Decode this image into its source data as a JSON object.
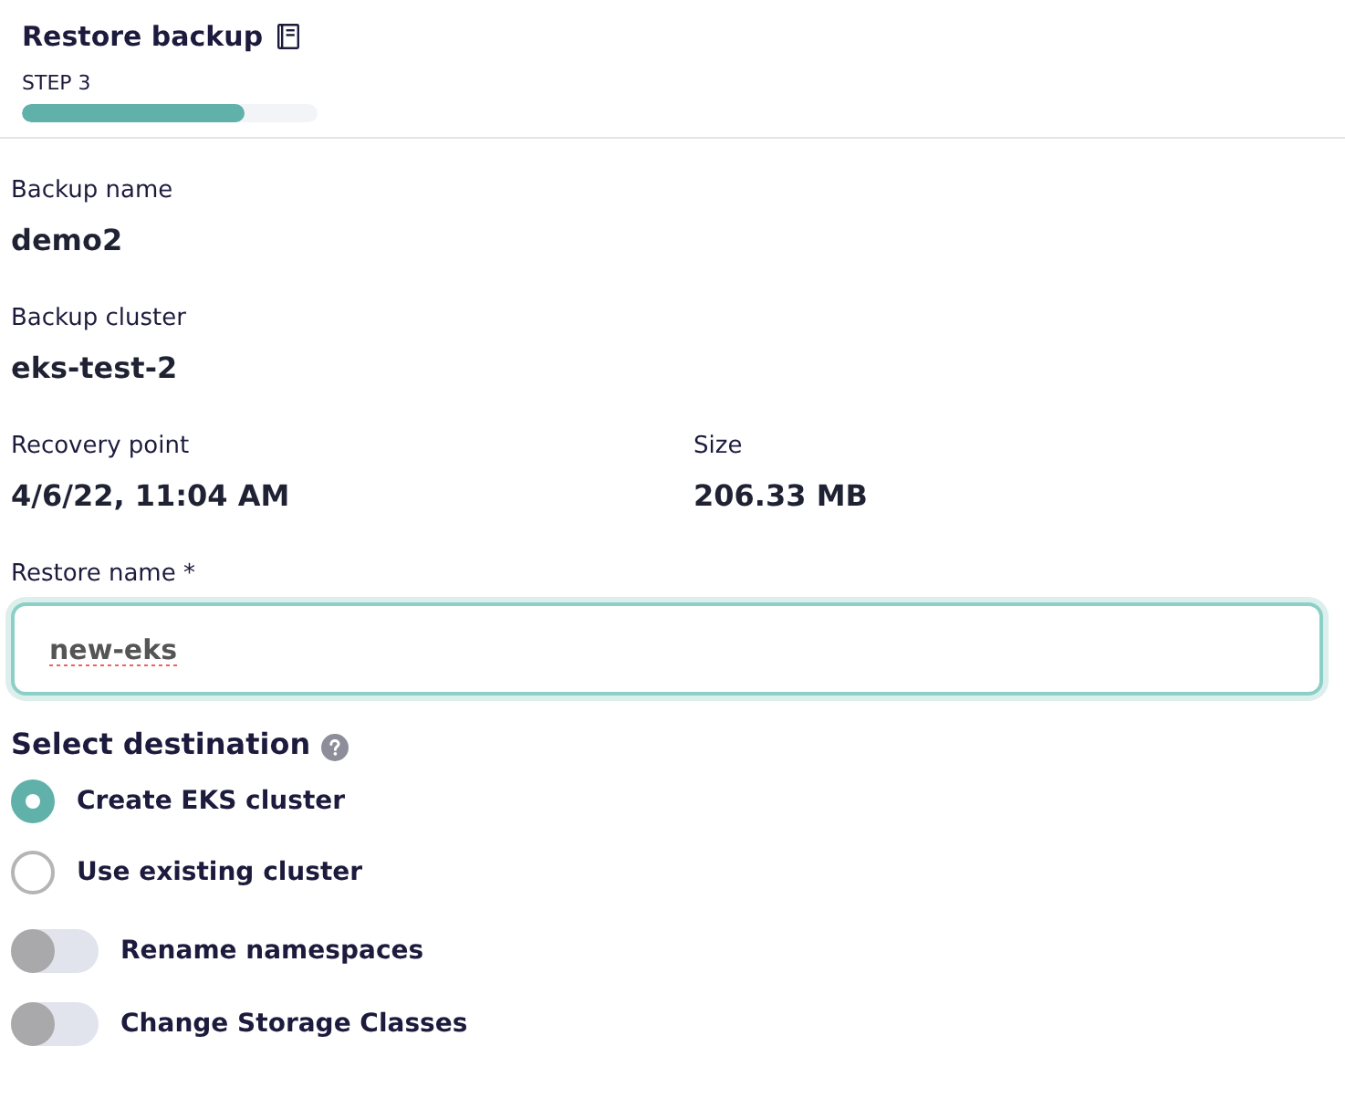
{
  "header": {
    "title": "Restore backup",
    "step": "STEP 3",
    "progress": {
      "level": 0.75
    }
  },
  "details": [
    [
      {
        "label": "Backup name",
        "value": "demo2"
      }
    ],
    [
      {
        "label": "Backup cluster",
        "value": "eks-test-2"
      }
    ],
    [
      {
        "label": "Recovery point",
        "value": "4/6/22, 11:04 AM"
      },
      {
        "label": "Size",
        "value": "206.33 MB"
      }
    ]
  ],
  "restore_name": {
    "label": "Restore name *",
    "value": "new-eks",
    "focused": true,
    "spelling_error": true
  },
  "destination": {
    "title": "Select destination",
    "options": [
      {
        "label": "Create EKS cluster",
        "selected": true
      },
      {
        "label": "Use existing cluster",
        "selected": false
      }
    ]
  },
  "toggles": [
    {
      "label": "Rename namespaces",
      "on": false
    },
    {
      "label": "Change Storage Classes",
      "on": false
    }
  ]
}
